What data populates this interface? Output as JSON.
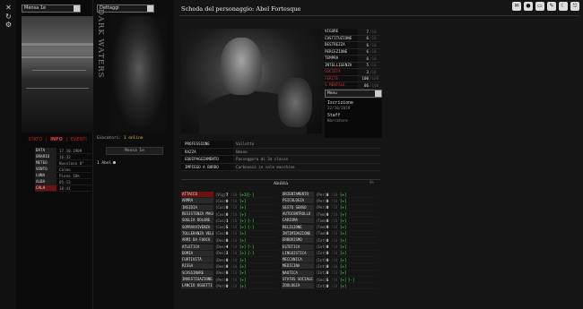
{
  "left_icons": [
    "close-icon",
    "refresh-icon",
    "gear-icon"
  ],
  "location_select": "Mensa 1e",
  "status_tabs": {
    "stato": "STATO",
    "info": "INFO",
    "eventi": "EVENTI",
    "sep": "|"
  },
  "weather": [
    {
      "k": "DATA",
      "v": "17.10.1909"
    },
    {
      "k": "ORARIO",
      "v": "16:32"
    },
    {
      "k": "METEO",
      "v": "Nuvoloso 8°"
    },
    {
      "k": "VENTO",
      "v": "Calmo"
    },
    {
      "k": "LUNA",
      "v": "Piena 10%"
    },
    {
      "k": "ALBA",
      "v": "05:13"
    },
    {
      "k": "CALA",
      "v": "18:41",
      "red": true
    }
  ],
  "category_select": "Dettaggi",
  "dark_waters": "DARK WATERS",
  "online": {
    "label": "Giocatori:",
    "count": "1 online"
  },
  "search_button": "Mensa 1e",
  "category_item": "1 Abel",
  "main": {
    "title": "Scheda del personaggio: Abel Fortesque",
    "top_icons": [
      "mail-icon",
      "chat-icon",
      "map-icon",
      "book-icon",
      "moon-icon",
      "logout-icon"
    ]
  },
  "stats": [
    {
      "k": "VIGORE",
      "v": "7",
      "m": "/10"
    },
    {
      "k": "COSTITUZIONE",
      "v": "6",
      "m": "/10"
    },
    {
      "k": "DESTREZZA",
      "v": "6",
      "m": "/10"
    },
    {
      "k": "PERCEZIONE",
      "v": "6",
      "m": "/10"
    },
    {
      "k": "TEMPRA",
      "v": "6",
      "m": "/10"
    },
    {
      "k": "INTELLIGENZA",
      "v": "5",
      "m": "/10"
    },
    {
      "k": "SOCIETA",
      "v": "3",
      "m": "/10",
      "red": true
    },
    {
      "k": "FERITE",
      "v": "100",
      "m": "/100",
      "red": true
    },
    {
      "k": "S.MENTALE",
      "v": "86",
      "m": "/100",
      "red": true
    }
  ],
  "menu_select": "Menu",
  "info_box": {
    "title": "Iscrizione",
    "date": "22/10/2019",
    "role": "Staff",
    "role_sub": "Narratore"
  },
  "profile": [
    {
      "k": "PROFESSIONE PREDEFINITA",
      "v": "Valletto"
    },
    {
      "k": "RAZZA",
      "v": "Umano"
    },
    {
      "k": "EQUIPAGGIAMENTO",
      "v": "Passeggero di 3a classe"
    },
    {
      "k": "IMPIEGO A BORDO",
      "v": "Carbonaio in sala macchine"
    }
  ],
  "abilita_title": "Abilità",
  "abilita_pct": "0%",
  "skills_left": [
    {
      "n": "ATTACCO",
      "a": "(Vig)",
      "v": "7",
      "m": "/10",
      "b1": "[+1]",
      "b2": "[-]",
      "hi": true
    },
    {
      "n": "ARMRA",
      "a": "(Cos)",
      "v": "0",
      "m": "/10",
      "b1": "[+]",
      "b2": ""
    },
    {
      "n": "INSIDIA",
      "a": "(Cos)",
      "v": "0",
      "m": "/10",
      "b1": "[+]",
      "b2": ""
    },
    {
      "n": "RESISTENZA MAGGIE",
      "a": "(Cos)",
      "v": "0",
      "m": "/10",
      "b1": "[+]",
      "b2": ""
    },
    {
      "n": "SOGLIA DOLORE",
      "a": "(Cos)",
      "v": "1",
      "m": "/10",
      "b1": "[+]",
      "b2": "[-]"
    },
    {
      "n": "SOPRAVVIVENZA",
      "a": "(Cos)",
      "v": "5",
      "m": "/10",
      "b1": "[+]",
      "b2": "[-]"
    },
    {
      "n": "TOLLERANZA VELENI",
      "a": "(Cos)",
      "v": "0",
      "m": "/10",
      "b1": "[+]",
      "b2": ""
    },
    {
      "n": "ARMI DA FUOCO",
      "a": "(Des)",
      "v": "0",
      "m": "/10",
      "b1": "[+]",
      "b2": ""
    },
    {
      "n": "ATLETICA",
      "a": "(Des)",
      "v": "4",
      "m": "/10",
      "b1": "[+]",
      "b2": "[-]"
    },
    {
      "n": "DOMIA",
      "a": "(Des)",
      "v": "2",
      "m": "/10",
      "b1": "[+]",
      "b2": "[-]"
    },
    {
      "n": "FURTIVITÀ",
      "a": "(Des)",
      "v": "0",
      "m": "/10",
      "b1": "[+]",
      "b2": ""
    },
    {
      "n": "RISSA",
      "a": "(Des)",
      "v": "0",
      "m": "/10",
      "b1": "[+]",
      "b2": ""
    },
    {
      "n": "SCASSINARE",
      "a": "(Des)",
      "v": "0",
      "m": "/10",
      "b1": "[+]",
      "b2": ""
    },
    {
      "n": "INVESTIGAZIONE",
      "a": "(Per)",
      "v": "0",
      "m": "/10",
      "b1": "[+]",
      "b2": ""
    },
    {
      "n": "LANCIO OGGETTI",
      "a": "(Per)",
      "v": "0",
      "m": "/10",
      "b1": "[+]",
      "b2": ""
    }
  ],
  "skills_right": [
    {
      "n": "ORIENTAMENTO",
      "a": "(Per)",
      "v": "0",
      "m": "/10",
      "b1": "[+]",
      "b2": ""
    },
    {
      "n": "PSICOLOGIA",
      "a": "(Per)",
      "v": "0",
      "m": "/10",
      "b1": "[+]",
      "b2": ""
    },
    {
      "n": "SESTO SENSO",
      "a": "(Per)",
      "v": "0",
      "m": "/10",
      "b1": "[+]",
      "b2": ""
    },
    {
      "n": "AUTOCONTROLLO",
      "a": "(Tem)",
      "v": "0",
      "m": "/10",
      "b1": "[+]",
      "b2": ""
    },
    {
      "n": "CARISMA",
      "a": "(Tem)",
      "v": "0",
      "m": "/10",
      "b1": "[+]",
      "b2": ""
    },
    {
      "n": "RELIGIONE",
      "a": "(Tem)",
      "v": "0",
      "m": "/10",
      "b1": "[+]",
      "b2": ""
    },
    {
      "n": "INTIMIDAZIONE",
      "a": "(Tem)",
      "v": "0",
      "m": "/10",
      "b1": "[+]",
      "b2": ""
    },
    {
      "n": "ERBORISMO",
      "a": "(Int)",
      "v": "0",
      "m": "/10",
      "b1": "[+]",
      "b2": ""
    },
    {
      "n": "ESTETICA",
      "a": "(Int)",
      "v": "0",
      "m": "/10",
      "b1": "[+]",
      "b2": ""
    },
    {
      "n": "LINGUISTICA",
      "a": "(Int)",
      "v": "0",
      "m": "/10",
      "b1": "[+]",
      "b2": ""
    },
    {
      "n": "MECCANICA",
      "a": "(Int)",
      "v": "0",
      "m": "/10",
      "b1": "[+]",
      "b2": ""
    },
    {
      "n": "MEDICINA",
      "a": "(Int)",
      "v": "0",
      "m": "/10",
      "b1": "[+]",
      "b2": ""
    },
    {
      "n": "NAUTICA",
      "a": "(Int)",
      "v": "0",
      "m": "/10",
      "b1": "[+]",
      "b2": ""
    },
    {
      "n": "STATUS SOCIALE",
      "a": "(Soc)",
      "v": "5",
      "m": "/10",
      "b1": "[+]",
      "b2": "[-]"
    },
    {
      "n": "ZOOLOGIA",
      "a": "(Int)",
      "v": "0",
      "m": "/10",
      "b1": "[+]",
      "b2": ""
    }
  ]
}
